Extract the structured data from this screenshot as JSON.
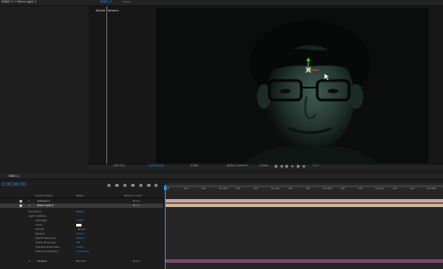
{
  "project_tab": "ENKO 2 • Point Light 1",
  "comp_tabs": [
    "ENKO 2",
    "Layer"
  ],
  "viewer": {
    "active_camera_label": "Active Camera",
    "zoom": "(49.4%)",
    "timecode": "0;00;00;00",
    "resolution": "(Half)",
    "view_mode": "Active Camera",
    "views": "1 View",
    "exposure": "+0.0"
  },
  "timeline": {
    "comp_name": "ENKO 2",
    "timecode": "0;00;00;00",
    "columns": {
      "source_name": "Source Name",
      "mode": "Mode",
      "parent": "Parent & Link"
    },
    "ruler": [
      "0f",
      "10f",
      "20f",
      "01:00f",
      "10f",
      "20f",
      "02:00f",
      "10f",
      "20f",
      "03:00f",
      "10f",
      "20f",
      "04:00f",
      "10f",
      "20f",
      "05:00f"
    ],
    "layers": [
      {
        "num": "1",
        "name": "Camera 1",
        "parent": "None",
        "color": "#c9a7a7"
      },
      {
        "num": "2",
        "name": "Point Light 1",
        "parent": "None",
        "color": "#c9b496",
        "selected": true
      }
    ],
    "transform": {
      "label": "Transform",
      "value": "Reset"
    },
    "light_options_label": "Light Options",
    "light_props": [
      {
        "name": "Intensity",
        "value": "100%"
      },
      {
        "name": "Color",
        "value": ""
      },
      {
        "name": "Falloff",
        "value": "None"
      },
      {
        "name": "Radius",
        "value": "500.0"
      },
      {
        "name": "Falloff Distance",
        "value": "500.0"
      },
      {
        "name": "Casts Shadows",
        "value": "Off"
      },
      {
        "name": "Shadow Darkness",
        "value": "100%"
      },
      {
        "name": "Shadow Diffusion",
        "value": "0.0 pixels"
      }
    ],
    "layer3": {
      "num": "3",
      "name": "wndow",
      "mode": "Normal",
      "parent": "None"
    }
  },
  "colors": {
    "accent": "#2d8ceb",
    "playhead": "#2d8ceb",
    "track_camera": "#c9a7a7",
    "track_light": "#c9b496"
  }
}
